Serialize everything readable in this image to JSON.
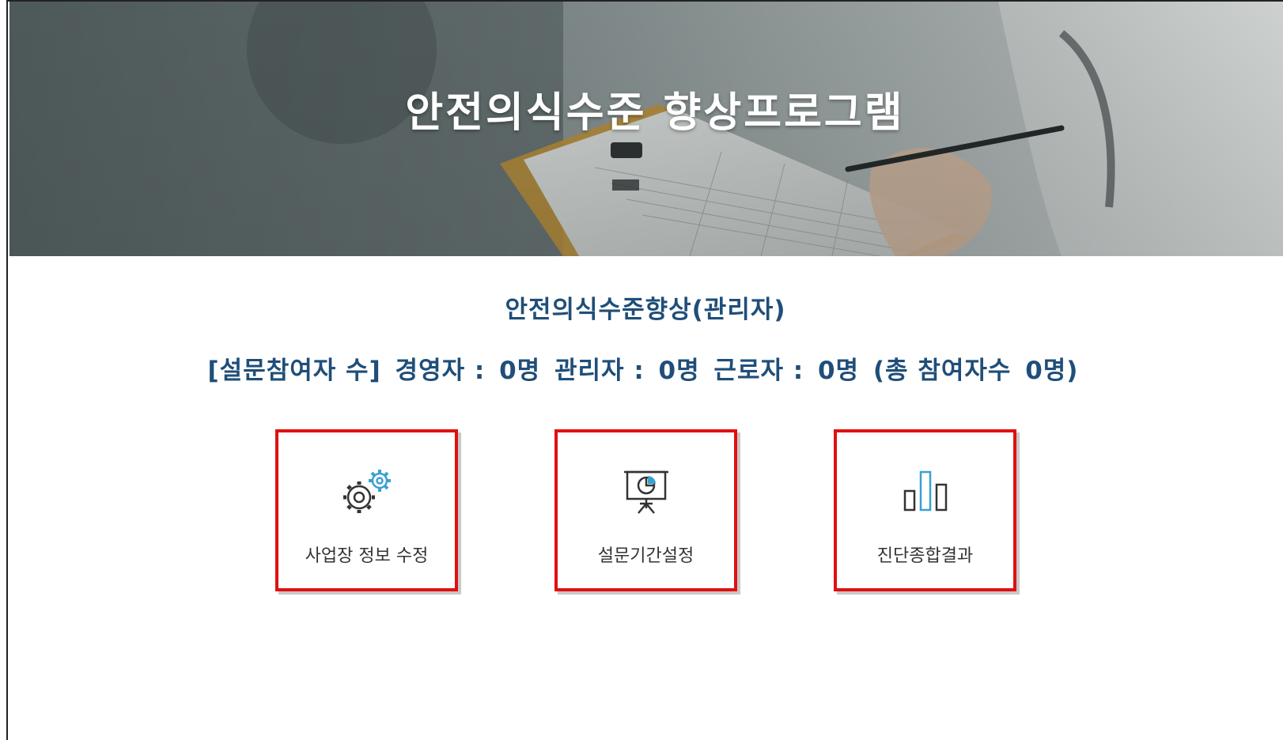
{
  "banner": {
    "title": "안전의식수준 향상프로그램"
  },
  "subtitle": "안전의식수준향상(관리자)",
  "stats": {
    "prefix": "[설문참여자 수]",
    "executive_label": "경영자 :",
    "executive_count": "0명",
    "manager_label": "관리자 :",
    "manager_count": "0명",
    "worker_label": "근로자 :",
    "worker_count": "0명",
    "total_label": "(총 참여자수",
    "total_count": "0명)"
  },
  "cards": [
    {
      "label": "사업장 정보 수정",
      "icon": "gears-icon"
    },
    {
      "label": "설문기간설정",
      "icon": "presentation-pie-icon"
    },
    {
      "label": "진단종합결과",
      "icon": "bar-chart-icon"
    }
  ],
  "colors": {
    "heading": "#1f4e79",
    "highlight_border": "#e01010",
    "icon_accent": "#3aa0d0",
    "icon_dark": "#333333"
  }
}
